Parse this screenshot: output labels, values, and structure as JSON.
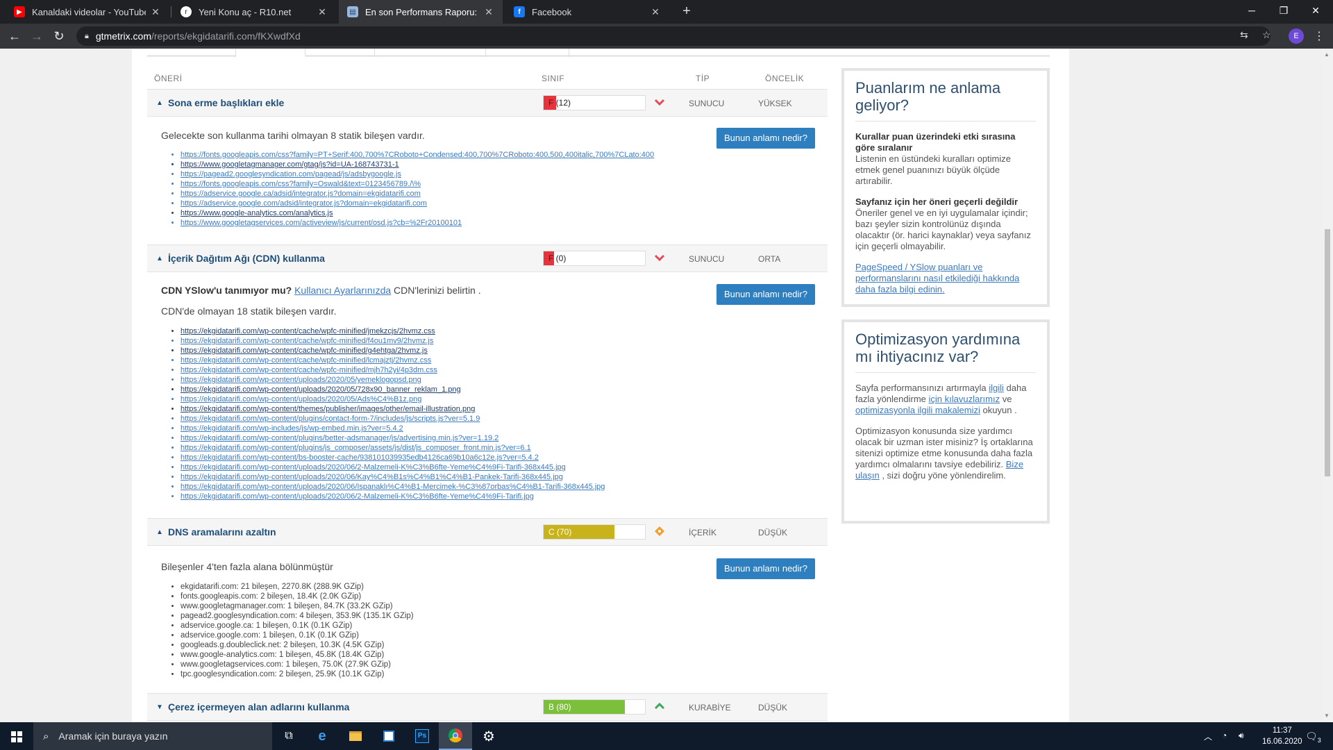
{
  "browser": {
    "tabs": [
      {
        "title": "Kanaldaki videolar - YouTube Stu",
        "favicon": "youtube-icon",
        "active": false
      },
      {
        "title": "Yeni Konu aç - R10.net",
        "favicon": "r10-icon",
        "active": false
      },
      {
        "title": "En son Performans Raporu: http:/",
        "favicon": "gtmetrix-icon",
        "active": true
      },
      {
        "title": "Facebook",
        "favicon": "facebook-icon",
        "active": false
      }
    ],
    "url_host": "gtmetrix.com",
    "url_path": "/reports/ekgidatarifi.com/fKXwdfXd",
    "profile_initial": "E"
  },
  "table": {
    "headers": {
      "rec": "ÖNERİ",
      "grade": "SINIF",
      "type": "TİP",
      "priority": "ÖNCELİK"
    },
    "help_button": "Bunun anlamı nedir?",
    "rules": [
      {
        "name": "Sona erme başlıkları ekle",
        "grade_text": "F (12)",
        "grade_value": 12,
        "grade_color": "#e8323c",
        "trend": "down",
        "type": "SUNUCU",
        "priority": "YÜKSEK",
        "description": "Gelecekte son kullanma tarihi olmayan 8 statik bileşen vardır.",
        "urls": [
          "https://fonts.googleapis.com/css?family=PT+Serif:400,700%7CRoboto+Condensed:400,700%7CRoboto:400,500,400italic,700%7CLato:400",
          "https://www.googletagmanager.com/gtag/js?id=UA-168743731-1",
          "https://pagead2.googlesyndication.com/pagead/js/adsbygoogle.js",
          "https://fonts.googleapis.com/css?family=Oswald&text=0123456789./\\%",
          "https://adservice.google.ca/adsid/integrator.js?domain=ekgidatarifi.com",
          "https://adservice.google.com/adsid/integrator.js?domain=ekgidatarifi.com",
          "https://www.google-analytics.com/analytics.js",
          "https://www.googletagservices.com/activeview/js/current/osd.js?cb=%2Fr20100101"
        ]
      },
      {
        "name": "İçerik Dağıtım Ağı (CDN) kullanma",
        "grade_text": "F (0)",
        "grade_value": 0,
        "grade_color": "#e8323c",
        "trend": "down",
        "type": "SUNUCU",
        "priority": "ORTA",
        "cdn_question": "CDN YSlow'u tanımıyor mu?",
        "cdn_link": "Kullanıcı Ayarlarınızda",
        "cdn_suffix": "CDN'lerinizi belirtin .",
        "description": "CDN'de olmayan 18 statik bileşen vardır.",
        "urls": [
          "https://ekgidatarifi.com/wp-content/cache/wpfc-minified/jmekzcjs/2hvmz.css",
          "https://ekgidatarifi.com/wp-content/cache/wpfc-minified/f4ou1mv9/2hvmz.js",
          "https://ekgidatarifi.com/wp-content/cache/wpfc-minified/g4ehtga/2hvmz.js",
          "https://ekgidatarifi.com/wp-content/cache/wpfc-minified/lcmajztj/2hvmz.css",
          "https://ekgidatarifi.com/wp-content/cache/wpfc-minified/mjh7h2yi/4p3dm.css",
          "https://ekgidatarifi.com/wp-content/uploads/2020/05/yemeklogopsd.png",
          "https://ekgidatarifi.com/wp-content/uploads/2020/05/728x90_banner_reklam_1.png",
          "https://ekgidatarifi.com/wp-content/uploads/2020/05/Ads%C4%B1z.png",
          "https://ekgidatarifi.com/wp-content/themes/publisher/images/other/email-illustration.png",
          "https://ekgidatarifi.com/wp-content/plugins/contact-form-7/includes/js/scripts.js?ver=5.1.9",
          "https://ekgidatarifi.com/wp-includes/js/wp-embed.min.js?ver=5.4.2",
          "https://ekgidatarifi.com/wp-content/plugins/better-adsmanager/js/advertising.min.js?ver=1.19.2",
          "https://ekgidatarifi.com/wp-content/plugins/js_composer/assets/js/dist/js_composer_front.min.js?ver=6.1",
          "https://ekgidatarifi.com/wp-content/bs-booster-cache/938101039935edb4126ca69b10a6c12e.js?ver=5.4.2",
          "https://ekgidatarifi.com/wp-content/uploads/2020/06/2-Malzemeli-K%C3%B6fte-Yeme%C4%9Fi-Tarifi-368x445.jpg",
          "https://ekgidatarifi.com/wp-content/uploads/2020/06/Kay%C4%B1s%C4%B1%C4%B1-Pankek-Tarifi-368x445.jpg",
          "https://ekgidatarifi.com/wp-content/uploads/2020/06/Ispanaklı%C4%B1-Mercimek-%C3%87orbas%C4%B1-Tarifi-368x445.jpg",
          "https://ekgidatarifi.com/wp-content/uploads/2020/06/2-Malzemeli-K%C3%B6fte-Yeme%C4%9Fi-Tarifi.jpg"
        ]
      },
      {
        "name": "DNS aramalarını azaltın",
        "grade_text": "C (70)",
        "grade_value": 70,
        "grade_color": "#c9b31c",
        "trend": "neutral",
        "type": "İÇERİK",
        "priority": "DÜŞÜK",
        "description": "Bileşenler 4'ten fazla alana bölünmüştür",
        "domains": [
          "ekgidatarifi.com: 21 bileşen, 2270.8K (288.9K GZip)",
          "fonts.googleapis.com: 2 bileşen, 18.4K (2.0K GZip)",
          "www.googletagmanager.com: 1 bileşen, 84.7K (33.2K GZip)",
          "pagead2.googlesyndication.com: 4 bileşen, 353.9K (135.1K GZip)",
          "adservice.google.ca: 1 bileşen, 0.1K (0.1K GZip)",
          "adservice.google.com: 1 bileşen, 0.1K (0.1K GZip)",
          "googleads.g.doubleclick.net: 2 bileşen, 10.3K (4.5K GZip)",
          "www.google-analytics.com: 1 bileşen, 45.8K (18.4K GZip)",
          "www.googletagservices.com: 1 bileşen, 75.0K (27.9K GZip)",
          "tpc.googlesyndication.com: 2 bileşen, 25.9K (10.1K GZip)"
        ]
      },
      {
        "name": "Çerez içermeyen alan adlarını kullanma",
        "grade_text": "B (80)",
        "grade_value": 80,
        "grade_color": "#7cbf3a",
        "trend": "up",
        "type": "KURABİYE",
        "priority": "DÜŞÜK"
      }
    ]
  },
  "sidebar": {
    "box1": {
      "title": "Puanlarım ne anlama geliyor?",
      "p1_bold": "Kurallar puan üzerindeki etki sırasına göre sıralanır",
      "p1_text": "Listenin en üstündeki kuralları optimize etmek genel puanınızı büyük ölçüde artırabilir.",
      "p2_bold": "Sayfanız için her öneri geçerli değildir",
      "p2_text": "Öneriler genel ve en iyi uygulamalar içindir; bazı şeyler sizin kontrolünüz dışında olacaktır (ör. harici kaynaklar) veya sayfanız için geçerli olmayabilir.",
      "link": "PageSpeed / YSlow puanları ve performanslarını nasıl etkilediği hakkında daha fazla bilgi edinin."
    },
    "box2": {
      "title": "Optimizasyon yardımına mı ihtiyacınız var?",
      "p1_a": "Sayfa performansınızı artırmayla",
      "p1_link1": "ilgili",
      "p1_b": "daha fazla yönlendirme",
      "p1_link2": "için kılavuzlarımız",
      "p1_c": "ve",
      "p1_link3": "optimizasyonla ilgili makalemizi",
      "p1_d": "okuyun .",
      "p2_a": "Optimizasyon konusunda size yardımcı olacak bir uzman ister misiniz? İş ortaklarına sitenizi optimize etme konusunda daha fazla yardımcı olmalarını tavsiye edebiliriz.",
      "p2_link": "Bize ulaşın",
      "p2_b": ", sizi doğru yöne yönlendirelim."
    }
  },
  "taskbar": {
    "search_placeholder": "Aramak için buraya yazın",
    "time": "11:37",
    "date": "16.06.2020",
    "notif_count": "3"
  }
}
